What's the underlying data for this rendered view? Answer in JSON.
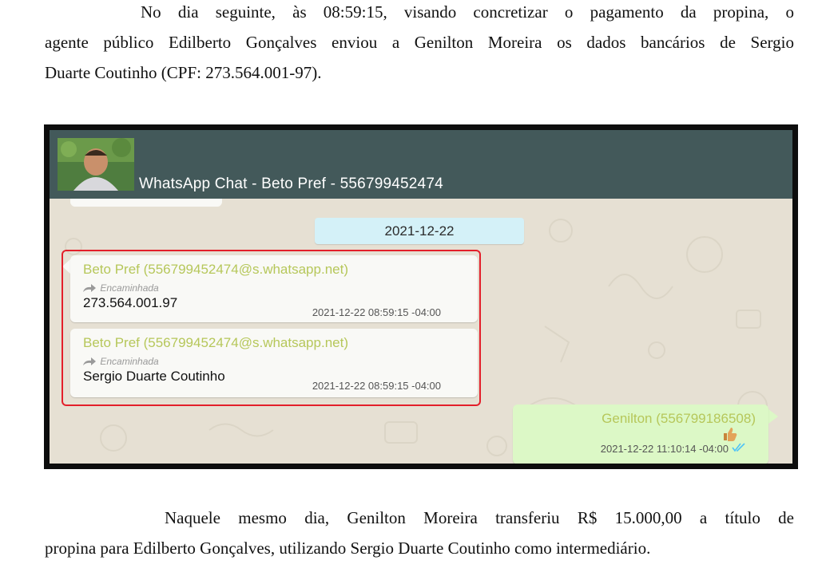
{
  "paragraph_top": {
    "lines": [
      "No dia seguinte, às 08:59:15, visando concretizar o pagamento da propina, o",
      "agente público Edilberto Gonçalves enviou a Genilton Moreira os dados bancários de Sergio",
      "Duarte Coutinho (CPF: 273.564.001-97)."
    ]
  },
  "whatsapp": {
    "header_title": "WhatsApp Chat - Beto Pref - 556799452474",
    "date_chip": "2021-12-22",
    "messages": [
      {
        "sender": "Beto Pref (556799452474@s.whatsapp.net)",
        "forwarded_label": "Encaminhada",
        "body": "273.564.001.97",
        "timestamp": "2021-12-22 08:59:15 -04:00"
      },
      {
        "sender": "Beto Pref (556799452474@s.whatsapp.net)",
        "forwarded_label": "Encaminhada",
        "body": "Sergio Duarte Coutinho",
        "timestamp": "2021-12-22 08:59:15 -04:00"
      },
      {
        "sender": "Genilton (556799186508)",
        "timestamp": "2021-12-22 11:10:14 -04:00",
        "icon": "thumbs-up-icon",
        "status_icon": "double-check-icon"
      }
    ],
    "highlight_color": "#e31f2a",
    "header_color": "#43595a",
    "sender_color": "#b6c75a"
  },
  "paragraph_bottom": {
    "lines": [
      "Naquele mesmo dia, Genilton Moreira transferiu R$ 15.000,00 a título de",
      "propina para Edilberto Gonçalves, utilizando Sergio Duarte Coutinho como intermediário."
    ]
  }
}
